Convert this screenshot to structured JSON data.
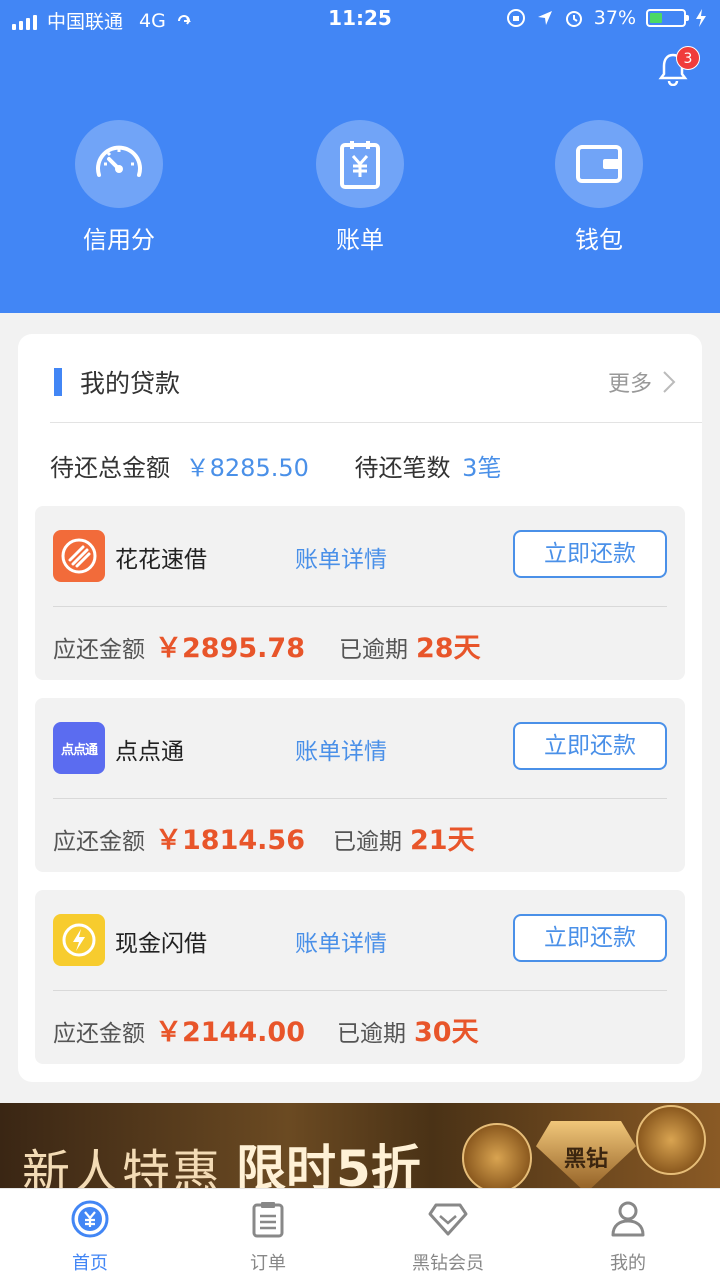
{
  "status_bar": {
    "carrier": "中国联通",
    "network": "4G",
    "time": "11:25",
    "battery": "37%"
  },
  "notifications": {
    "count": "3"
  },
  "quick_actions": [
    {
      "label": "信用分",
      "icon": "speedometer-icon"
    },
    {
      "label": "账单",
      "icon": "bill-icon"
    },
    {
      "label": "钱包",
      "icon": "wallet-icon"
    }
  ],
  "loans_card": {
    "title": "我的贷款",
    "more": "更多",
    "total_label": "待还总金额",
    "total_value": "￥8285.50",
    "count_label": "待还笔数",
    "count_value": "3笔"
  },
  "loans": [
    {
      "name": "花花速借",
      "detail": "账单详情",
      "pay": "立即还款",
      "due_label": "应还金额",
      "amount": "￥2895.78",
      "overdue_label": "已逾期",
      "days": "28天",
      "logo_color": "#f26b3a"
    },
    {
      "name": "点点通",
      "detail": "账单详情",
      "pay": "立即还款",
      "due_label": "应还金额",
      "amount": "￥1814.56",
      "overdue_label": "已逾期",
      "days": "21天",
      "logo_color": "#5b6cf0",
      "logo_text": "点点通"
    },
    {
      "name": "现金闪借",
      "detail": "账单详情",
      "pay": "立即还款",
      "due_label": "应还金额",
      "amount": "￥2144.00",
      "overdue_label": "已逾期",
      "days": "30天",
      "logo_color": "#f7cc2e"
    }
  ],
  "banner": {
    "text_1": "新人特惠",
    "text_2": "限时5折",
    "badge": "黑钻"
  },
  "tabs": [
    {
      "label": "首页",
      "active": true
    },
    {
      "label": "订单",
      "active": false
    },
    {
      "label": "黑钻会员",
      "active": false
    },
    {
      "label": "我的",
      "active": false
    }
  ],
  "colors": {
    "primary": "#4286f5",
    "link": "#4a90e8",
    "alert": "#e8552a"
  }
}
